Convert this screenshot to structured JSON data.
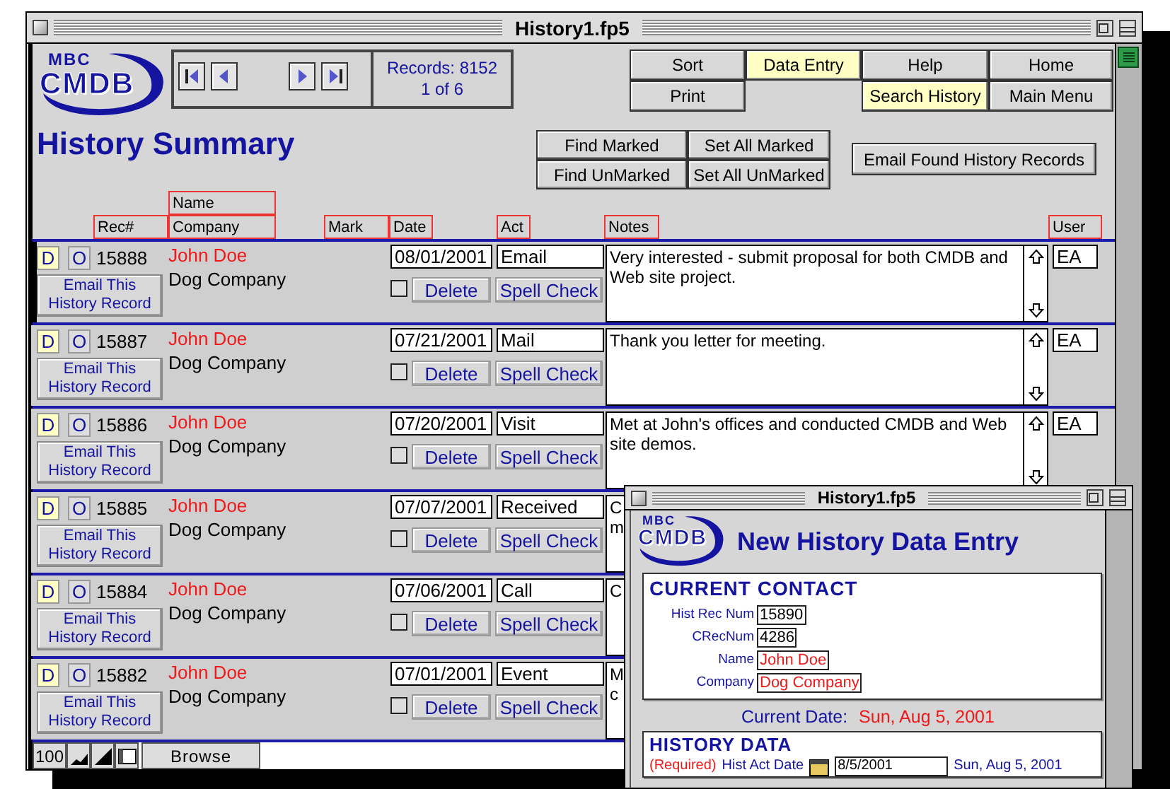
{
  "main_window": {
    "title": "History1.fp5",
    "logo": {
      "small": "MBC",
      "large": "CMDB"
    },
    "records": {
      "count": "Records: 8152",
      "position": "1 of 6"
    },
    "menu": [
      {
        "label": "Sort",
        "highlighted": false
      },
      {
        "label": "Data Entry",
        "highlighted": true
      },
      {
        "label": "Help",
        "highlighted": false
      },
      {
        "label": "Home",
        "highlighted": false
      },
      {
        "label": "Print",
        "highlighted": false
      },
      {
        "label": "Search History",
        "highlighted": true
      },
      {
        "label": "Main Menu",
        "highlighted": false
      }
    ],
    "heading": "History Summary",
    "mark_buttons": [
      "Find Marked",
      "Set All Marked",
      "Find UnMarked",
      "Set All UnMarked"
    ],
    "email_found_button": "Email Found History Records",
    "columns": {
      "name": "Name",
      "rec": "Rec#",
      "company": "Company",
      "mark": "Mark",
      "date": "Date",
      "act": "Act",
      "notes": "Notes",
      "user": "User"
    },
    "rows": [
      {
        "current": true,
        "d": "D",
        "o": "O",
        "rec": "15888",
        "name": "John Doe",
        "company": "Dog Company",
        "email": "Email This History Record",
        "date": "08/01/2001",
        "act": "Email",
        "marked": false,
        "delete": "Delete",
        "spell": "Spell Check",
        "notes": "Very interested - submit proposal for both CMDB and Web site project.",
        "user": "EA"
      },
      {
        "current": false,
        "d": "D",
        "o": "O",
        "rec": "15887",
        "name": "John Doe",
        "company": "Dog Company",
        "email": "Email This History Record",
        "date": "07/21/2001",
        "act": "Mail",
        "marked": false,
        "delete": "Delete",
        "spell": "Spell Check",
        "notes": "Thank you letter for meeting.",
        "user": "EA"
      },
      {
        "current": false,
        "d": "D",
        "o": "O",
        "rec": "15886",
        "name": "John Doe",
        "company": "Dog Company",
        "email": "Email This History Record",
        "date": "07/20/2001",
        "act": "Visit",
        "marked": false,
        "delete": "Delete",
        "spell": "Spell Check",
        "notes": "Met at John's offices and conducted CMDB and Web site demos.",
        "user": "EA"
      },
      {
        "current": false,
        "d": "D",
        "o": "O",
        "rec": "15885",
        "name": "John Doe",
        "company": "Dog Company",
        "email": "Email This History Record",
        "date": "07/07/2001",
        "act": "Received",
        "marked": false,
        "delete": "Delete",
        "spell": "Spell Check",
        "notes": "C\nm"
      },
      {
        "current": false,
        "d": "D",
        "o": "O",
        "rec": "15884",
        "name": "John Doe",
        "company": "Dog Company",
        "email": "Email This History Record",
        "date": "07/06/2001",
        "act": "Call",
        "marked": false,
        "delete": "Delete",
        "spell": "Spell Check",
        "notes": "C"
      },
      {
        "current": false,
        "d": "D",
        "o": "O",
        "rec": "15882",
        "name": "John Doe",
        "company": "Dog Company",
        "email": "Email This History Record",
        "date": "07/01/2001",
        "act": "Event",
        "marked": false,
        "delete": "Delete",
        "spell": "Spell Check",
        "notes": "M\nc"
      }
    ],
    "status_bar": {
      "zoom": "100",
      "mode": "Browse"
    }
  },
  "entry_window": {
    "title": "History1.fp5",
    "logo": {
      "small": "MBC",
      "large": "CMDB"
    },
    "heading": "New History Data Entry",
    "contact": {
      "title": "CURRENT CONTACT",
      "fields": [
        {
          "label": "Hist Rec Num",
          "value": "15890",
          "kind": "short"
        },
        {
          "label": "CRecNum",
          "value": "4286",
          "kind": "short"
        },
        {
          "label": "Name",
          "value": "John Doe",
          "kind": "long"
        },
        {
          "label": "Company",
          "value": "Dog Company",
          "kind": "long"
        }
      ]
    },
    "current_date": {
      "label": "Current Date:",
      "value": "Sun, Aug 5, 2001"
    },
    "history": {
      "title": "HISTORY DATA",
      "required": "(Required)",
      "label": "Hist Act Date",
      "value": "8/5/2001",
      "day": "Sun, Aug 5, 2001"
    }
  }
}
